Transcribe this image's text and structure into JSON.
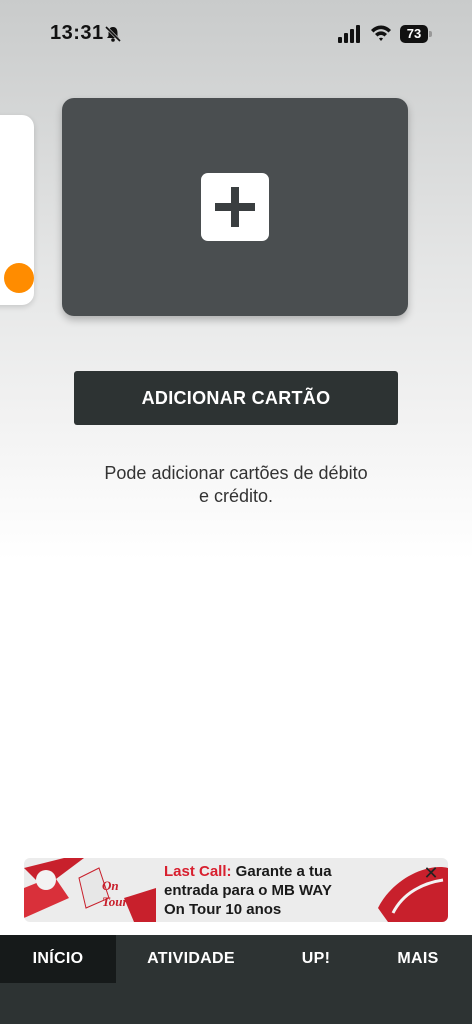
{
  "status_bar": {
    "time": "13:31",
    "battery": "73"
  },
  "add_card": {
    "icon": "plus-icon"
  },
  "add_button": {
    "label": "ADICIONAR CARTÃO"
  },
  "hint": {
    "line1": "Pode adicionar cartões de débito",
    "line2": "e crédito."
  },
  "banner": {
    "accent": "Last Call:",
    "text1": " Garante a tua",
    "text2": "entrada para o MB WAY",
    "text3": "On Tour 10 anos",
    "close": "✕",
    "art_text": "On Tour"
  },
  "nav": {
    "tabs": [
      {
        "label": "INÍCIO",
        "active": true
      },
      {
        "label": "ATIVIDADE",
        "active": false
      },
      {
        "label": "UP!",
        "active": false
      },
      {
        "label": "MAIS",
        "active": false
      }
    ]
  },
  "colors": {
    "accent_orange": "#ff8c00",
    "button_dark": "#2d3333",
    "banner_red": "#d8202f"
  }
}
